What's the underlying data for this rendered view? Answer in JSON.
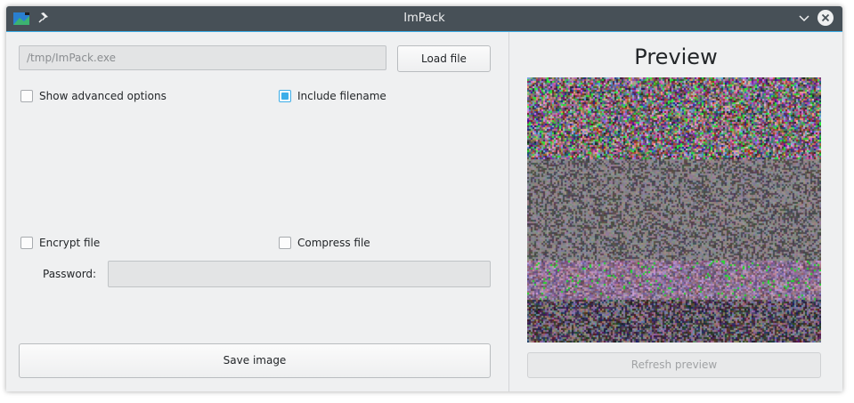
{
  "window": {
    "title": "ImPack"
  },
  "icons": {
    "app": "impack-app-icon",
    "pin": "pin-icon",
    "minimize": "chevron-down-icon",
    "close": "close-icon"
  },
  "file": {
    "path_value": "/tmp/ImPack.exe",
    "load_label": "Load file"
  },
  "options": {
    "show_advanced": {
      "label": "Show advanced options",
      "checked": false
    },
    "include_filename": {
      "label": "Include filename",
      "checked": true
    },
    "encrypt": {
      "label": "Encrypt file",
      "checked": false
    },
    "compress": {
      "label": "Compress file",
      "checked": false
    }
  },
  "password": {
    "label": "Password:",
    "value": ""
  },
  "save_label": "Save image",
  "preview": {
    "title": "Preview",
    "refresh_label": "Refresh preview",
    "refresh_enabled": false
  },
  "colors": {
    "accent": "#3daee9",
    "titlebar": "#475057",
    "window_bg": "#eff0f1"
  }
}
